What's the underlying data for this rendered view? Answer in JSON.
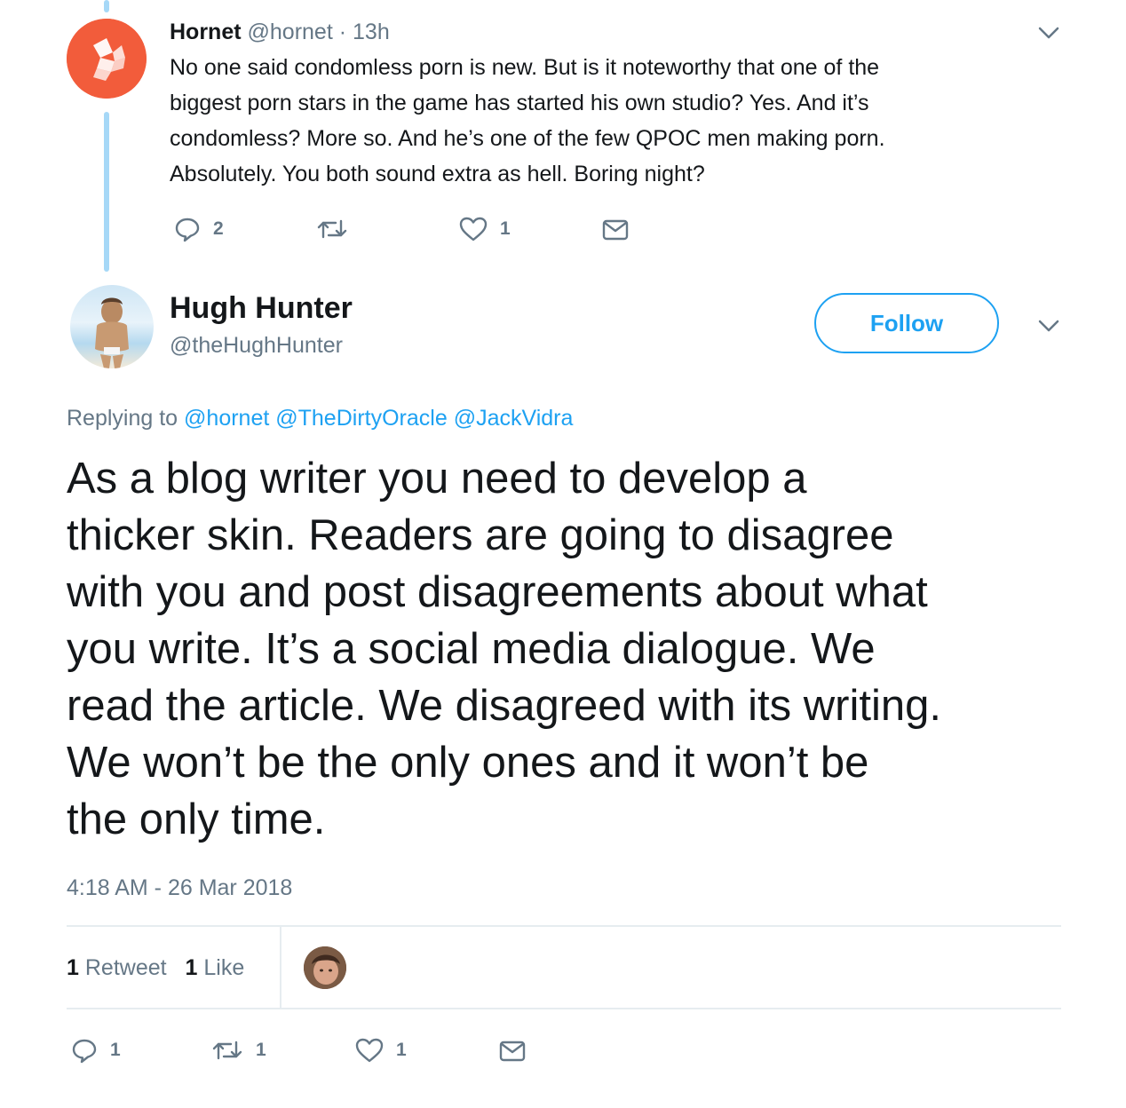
{
  "parent_tweet": {
    "name": "Hornet",
    "handle": "@hornet",
    "separator": "·",
    "time": "13h",
    "text_lines": [
      "No one said condomless porn is new. But is it noteworthy that one of the",
      "biggest porn stars in the game has started his own studio? Yes. And it’s",
      "condomless? More so. And he’s one of the few QPOC men making porn.",
      "Absolutely. You both sound extra as hell. Boring night?"
    ],
    "reply_count": "2",
    "retweet_count": "",
    "like_count": "1",
    "avatar_color": "#f25c3b"
  },
  "main_tweet": {
    "name": "Hugh Hunter",
    "handle": "@theHughHunter",
    "follow_label": "Follow",
    "replying_prefix": "Replying to",
    "replying_to": [
      "@hornet",
      "@TheDirtyOracle",
      "@JackVidra"
    ],
    "text_lines": [
      "As a blog writer you need to develop a",
      "thicker skin. Readers are going to disagree",
      "with you and post disagreements about what",
      "you write. It’s a social media dialogue. We",
      "read the article. We disagreed with its writing.",
      "We won’t be the only ones and it won’t be",
      "the only time."
    ],
    "timestamp": "4:18 AM - 26 Mar 2018",
    "stats": {
      "retweets_count": "1",
      "retweets_label": "Retweet",
      "likes_count": "1",
      "likes_label": "Like"
    },
    "reply_count": "1",
    "retweet_count": "1",
    "like_count": "1"
  },
  "colors": {
    "accent": "#1da1f2",
    "muted": "#657786",
    "thread_line": "#a6d8f7",
    "divider": "#e6ecf0"
  },
  "icons": [
    "chevron-down-icon",
    "reply-icon",
    "retweet-icon",
    "like-icon",
    "dm-icon"
  ]
}
